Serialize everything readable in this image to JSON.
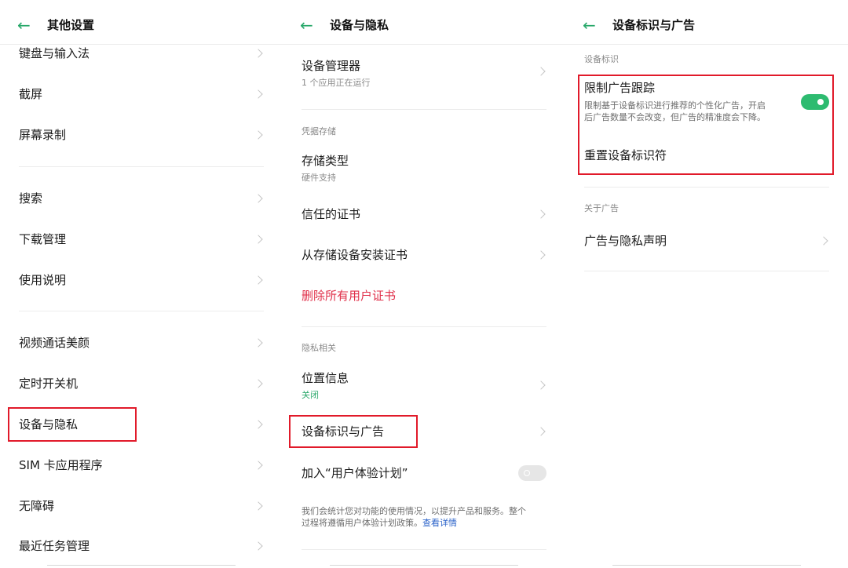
{
  "panel1": {
    "title": "其他设置",
    "items": [
      "键盘与输入法",
      "截屏",
      "屏幕录制",
      "搜索",
      "下载管理",
      "使用说明",
      "视频通话美颜",
      "定时开关机",
      "设备与隐私",
      "SIM 卡应用程序",
      "无障碍",
      "最近任务管理"
    ]
  },
  "panel2": {
    "title": "设备与隐私",
    "device_manager": {
      "label": "设备管理器",
      "sub": "1 个应用正在运行"
    },
    "cred_section": "凭据存储",
    "storage_type": {
      "label": "存储类型",
      "sub": "硬件支持"
    },
    "trusted_certs": "信任的证书",
    "install_certs": "从存储设备安装证书",
    "delete_certs": "删除所有用户证书",
    "privacy_section": "隐私相关",
    "location": {
      "label": "位置信息",
      "sub": "关闭"
    },
    "device_id_ads": "设备标识与广告",
    "ux_plan": "加入“用户体验计划”",
    "ux_desc_1": "我们会统计您对功能的使用情况，以提升产品和服务。整个",
    "ux_desc_2": "过程将遵循用户体验计划政策。",
    "ux_link": "查看详情"
  },
  "panel3": {
    "title": "设备标识与广告",
    "section_id": "设备标识",
    "limit_tracking": {
      "label": "限制广告跟踪",
      "desc_1": "限制基于设备标识进行推荐的个性化广告，开启",
      "desc_2": "后广告数量不会改变，但广告的精准度会下降。",
      "enabled": true
    },
    "reset_id": "重置设备标识符",
    "section_ads": "关于广告",
    "ad_privacy": "广告与隐私声明"
  },
  "colors": {
    "accent": "#2dbb70",
    "highlight": "#e11a2a",
    "danger": "#e0304a",
    "link": "#2a62c9"
  }
}
